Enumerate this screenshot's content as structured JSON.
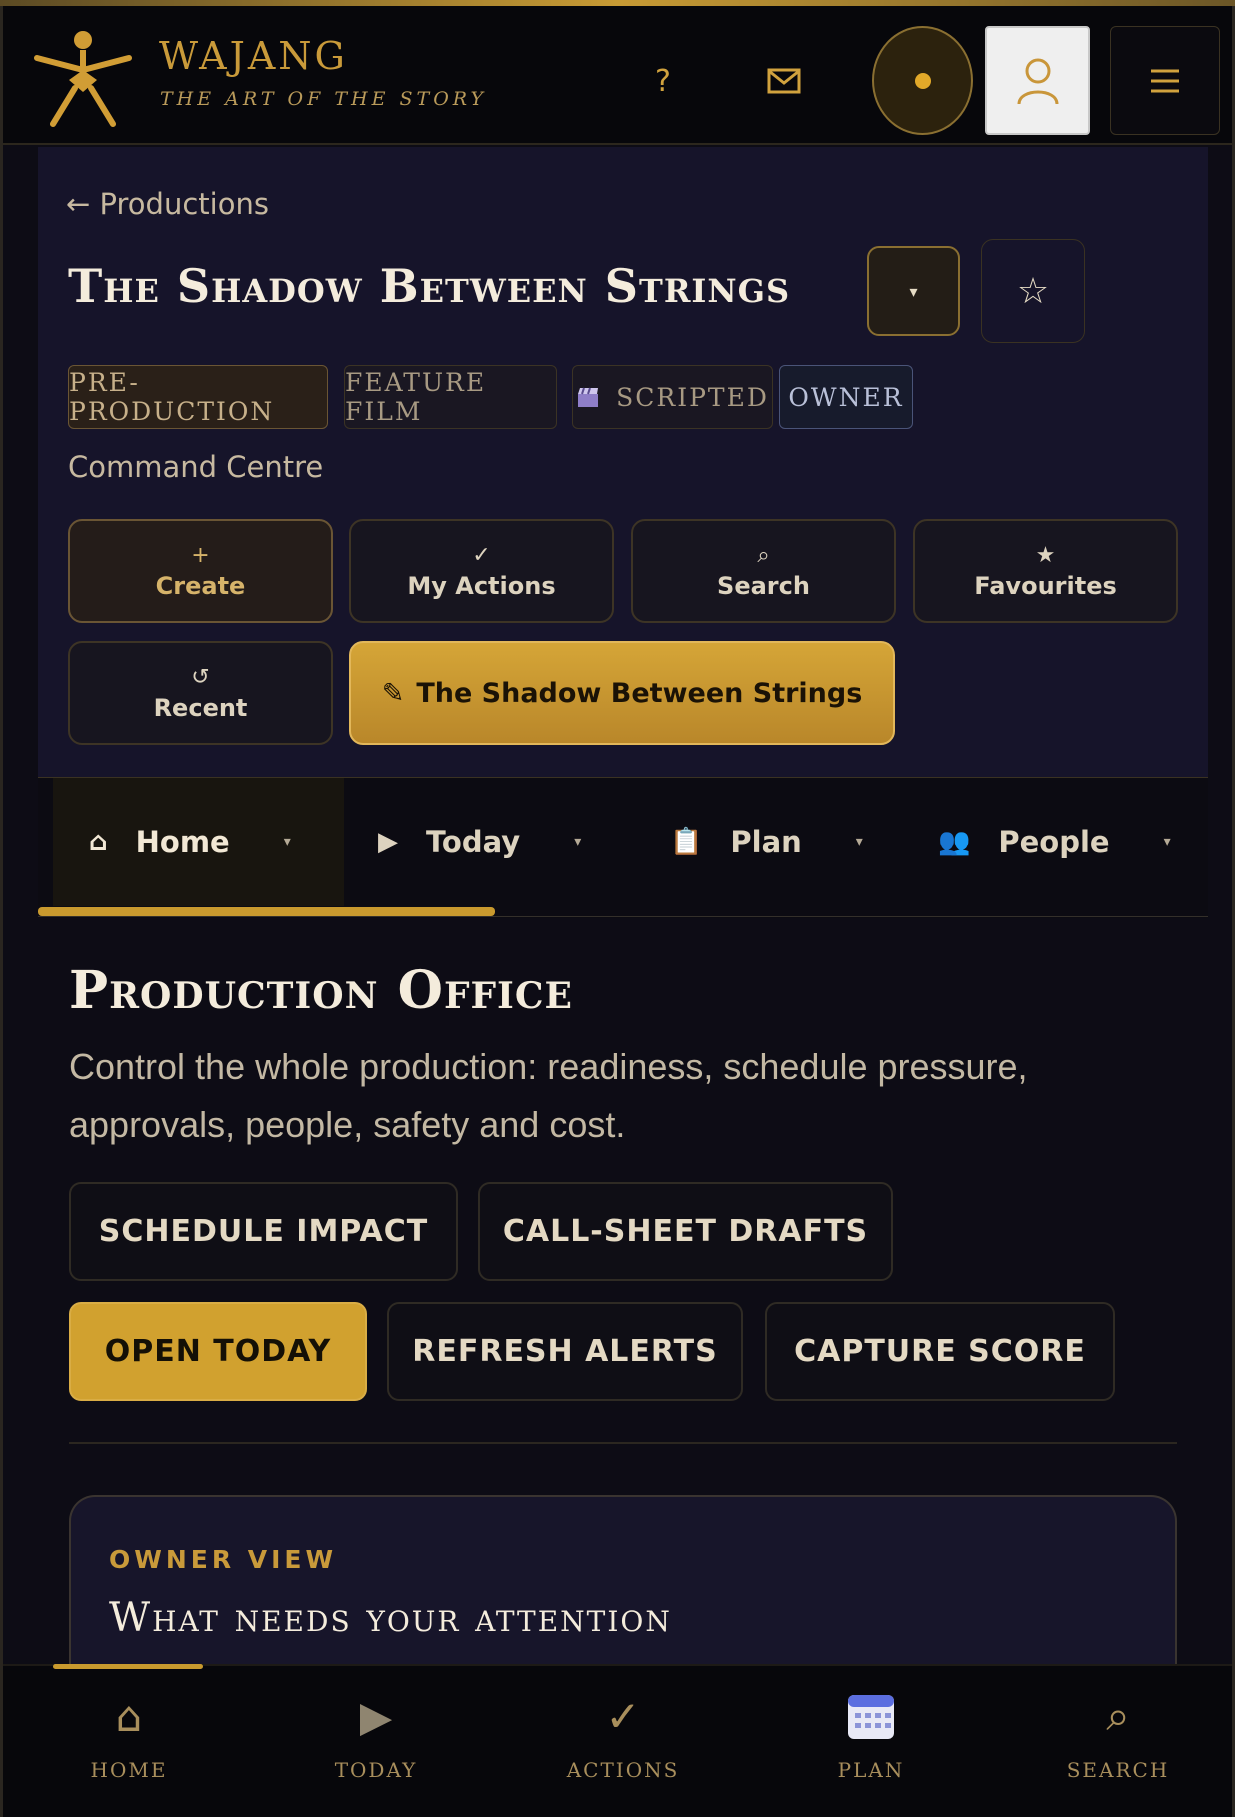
{
  "app": {
    "brand": "WAJANG",
    "tagline": "THE ART OF THE STORY",
    "help_label": "?",
    "accent_color": "#c99a2e"
  },
  "header": {
    "icons": [
      "wayang-logo-icon",
      "help-icon",
      "mail-icon",
      "status-dot-icon",
      "user-icon",
      "hamburger-menu-icon"
    ]
  },
  "breadcrumb": {
    "arrow": "←",
    "label": "Productions"
  },
  "production": {
    "title": "The Shadow Between Strings",
    "caret": "▾",
    "star": "☆",
    "chips": [
      "PRE-PRODUCTION",
      "FEATURE FILM",
      "SCRIPTED",
      "OWNER"
    ]
  },
  "command_centre": {
    "label": "Command Centre",
    "actions": [
      {
        "icon": "+",
        "label": "Create"
      },
      {
        "icon": "✓",
        "label": "My Actions"
      },
      {
        "icon": "⌕",
        "label": "Search"
      },
      {
        "icon": "★",
        "label": "Favourites"
      },
      {
        "icon": "↺",
        "label": "Recent"
      },
      {
        "icon": "✎",
        "label": "The Shadow Between Strings"
      }
    ]
  },
  "tabs": [
    {
      "icon": "⌂",
      "label": "Home",
      "caret": "▾"
    },
    {
      "icon": "▶",
      "label": "Today",
      "caret": "▾"
    },
    {
      "icon": "📋",
      "label": "Plan",
      "caret": "▾"
    },
    {
      "icon": "👥",
      "label": "People",
      "caret": "▾"
    }
  ],
  "office": {
    "title": "Production Office",
    "description": "Control the whole production: readiness, schedule pressure, approvals, people, safety and cost.",
    "buttons": [
      "SCHEDULE IMPACT",
      "CALL-SHEET DRAFTS",
      "OPEN TODAY",
      "REFRESH ALERTS",
      "CAPTURE SCORE"
    ]
  },
  "owner_card": {
    "eyebrow": "OWNER VIEW",
    "title": "What needs your attention"
  },
  "bottom_nav": [
    {
      "icon": "⌂",
      "label": "HOME"
    },
    {
      "icon": "▶",
      "label": "TODAY"
    },
    {
      "icon": "✓",
      "label": "ACTIONS"
    },
    {
      "icon": "calendar-icon",
      "label": "PLAN"
    },
    {
      "icon": "⌕",
      "label": "SEARCH"
    }
  ]
}
